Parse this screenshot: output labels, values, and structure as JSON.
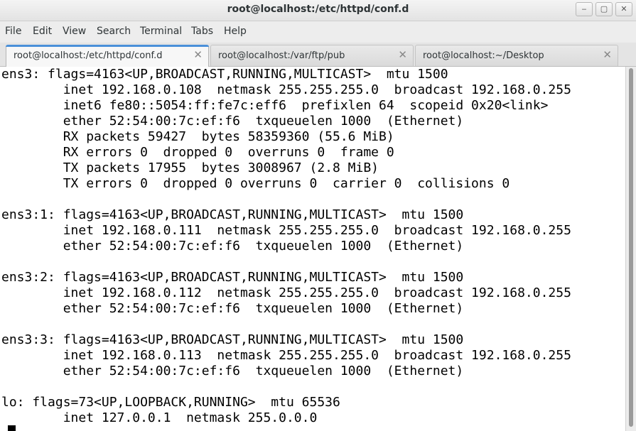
{
  "window": {
    "title": "root@localhost:/etc/httpd/conf.d"
  },
  "controls": {
    "minimize": "‒",
    "maximize": "▢",
    "close": "✕"
  },
  "menu": [
    "File",
    "Edit",
    "View",
    "Search",
    "Terminal",
    "Tabs",
    "Help"
  ],
  "tabs": [
    {
      "label": "root@localhost:/etc/httpd/conf.d",
      "close": "✕"
    },
    {
      "label": "root@localhost:/var/ftp/pub",
      "close": "✕"
    },
    {
      "label": "root@localhost:~/Desktop",
      "close": "✕"
    }
  ],
  "terminal": {
    "lines": [
      "ens3: flags=4163<UP,BROADCAST,RUNNING,MULTICAST>  mtu 1500",
      "        inet 192.168.0.108  netmask 255.255.255.0  broadcast 192.168.0.255",
      "        inet6 fe80::5054:ff:fe7c:eff6  prefixlen 64  scopeid 0x20<link>",
      "        ether 52:54:00:7c:ef:f6  txqueuelen 1000  (Ethernet)",
      "        RX packets 59427  bytes 58359360 (55.6 MiB)",
      "        RX errors 0  dropped 0  overruns 0  frame 0",
      "        TX packets 17955  bytes 3008967 (2.8 MiB)",
      "        TX errors 0  dropped 0 overruns 0  carrier 0  collisions 0",
      "",
      "ens3:1: flags=4163<UP,BROADCAST,RUNNING,MULTICAST>  mtu 1500",
      "        inet 192.168.0.111  netmask 255.255.255.0  broadcast 192.168.0.255",
      "        ether 52:54:00:7c:ef:f6  txqueuelen 1000  (Ethernet)",
      "",
      "ens3:2: flags=4163<UP,BROADCAST,RUNNING,MULTICAST>  mtu 1500",
      "        inet 192.168.0.112  netmask 255.255.255.0  broadcast 192.168.0.255",
      "        ether 52:54:00:7c:ef:f6  txqueuelen 1000  (Ethernet)",
      "",
      "ens3:3: flags=4163<UP,BROADCAST,RUNNING,MULTICAST>  mtu 1500",
      "        inet 192.168.0.113  netmask 255.255.255.0  broadcast 192.168.0.255",
      "        ether 52:54:00:7c:ef:f6  txqueuelen 1000  (Ethernet)",
      "",
      "lo: flags=73<UP,LOOPBACK,RUNNING>  mtu 65536",
      "        inet 127.0.0.1  netmask 255.0.0.0"
    ]
  },
  "colors": {
    "accent": "#4a90d9",
    "terminal_bg": "#ffffff",
    "terminal_fg": "#000000"
  }
}
